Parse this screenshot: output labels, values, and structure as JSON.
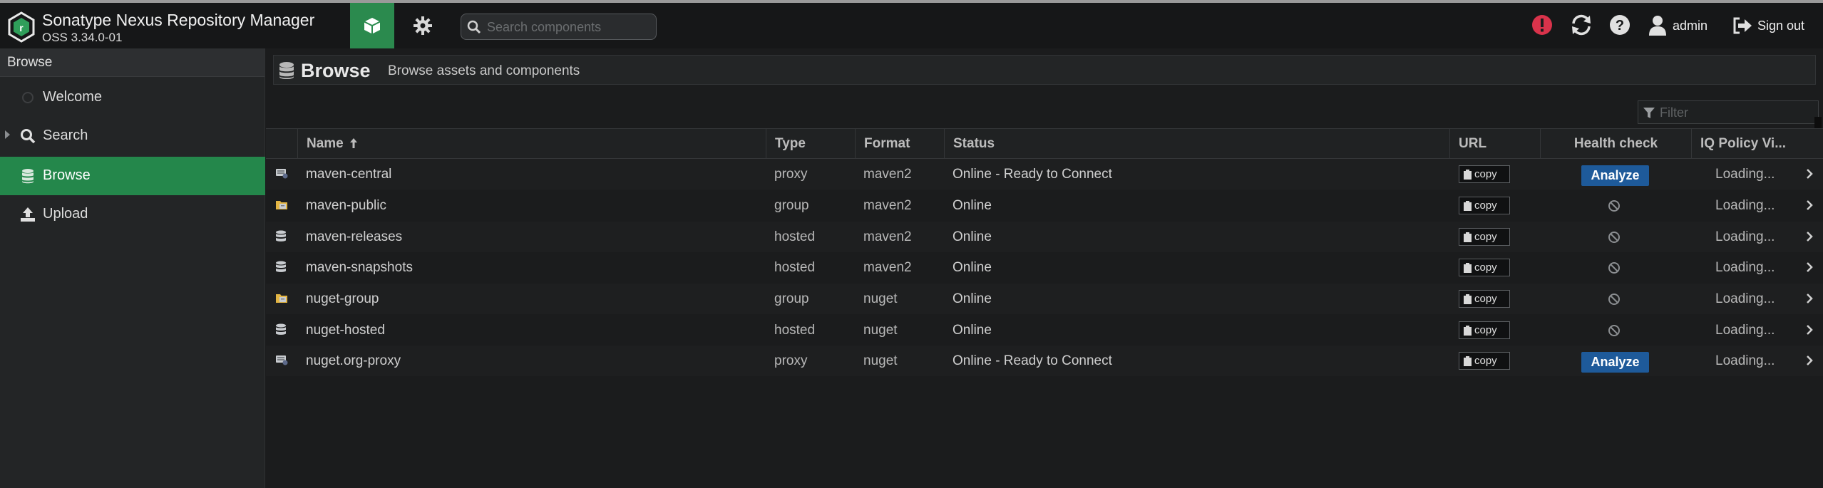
{
  "app": {
    "title": "Sonatype Nexus Repository Manager",
    "version": "OSS 3.34.0-01",
    "logo_letter": "r"
  },
  "header": {
    "browse_mode_icon": "cube-icon",
    "admin_mode_icon": "gear-icon",
    "search_placeholder": "Search components",
    "alert_icon": "alert-icon",
    "refresh_icon": "refresh-icon",
    "help_icon": "help-icon",
    "user_label": "admin",
    "signout_label": "Sign out"
  },
  "sidebar": {
    "heading": "Browse",
    "items": [
      {
        "label": "Welcome",
        "icon": "welcome-circle-icon",
        "expandable": false,
        "active": false
      },
      {
        "label": "Search",
        "icon": "search-icon",
        "expandable": true,
        "active": false
      },
      {
        "label": "Browse",
        "icon": "database-icon",
        "expandable": false,
        "active": true
      },
      {
        "label": "Upload",
        "icon": "upload-icon",
        "expandable": false,
        "active": false
      }
    ]
  },
  "main": {
    "title": "Browse",
    "subtitle": "Browse assets and components",
    "filter_placeholder": "Filter"
  },
  "table": {
    "columns": {
      "name": "Name",
      "type": "Type",
      "format": "Format",
      "status": "Status",
      "url": "URL",
      "health": "Health check",
      "iq": "IQ Policy Vi..."
    },
    "sort_icon": "sort-ascending-icon",
    "copy_label": "copy",
    "analyze_label": "Analyze",
    "rows": [
      {
        "name": "maven-central",
        "type": "proxy",
        "format": "maven2",
        "status": "Online - Ready to Connect",
        "health": "analyze",
        "iq": "Loading..."
      },
      {
        "name": "maven-public",
        "type": "group",
        "format": "maven2",
        "status": "Online",
        "health": "none",
        "iq": "Loading..."
      },
      {
        "name": "maven-releases",
        "type": "hosted",
        "format": "maven2",
        "status": "Online",
        "health": "none",
        "iq": "Loading..."
      },
      {
        "name": "maven-snapshots",
        "type": "hosted",
        "format": "maven2",
        "status": "Online",
        "health": "none",
        "iq": "Loading..."
      },
      {
        "name": "nuget-group",
        "type": "group",
        "format": "nuget",
        "status": "Online",
        "health": "none",
        "iq": "Loading..."
      },
      {
        "name": "nuget-hosted",
        "type": "hosted",
        "format": "nuget",
        "status": "Online",
        "health": "none",
        "iq": "Loading..."
      },
      {
        "name": "nuget.org-proxy",
        "type": "proxy",
        "format": "nuget",
        "status": "Online - Ready to Connect",
        "health": "analyze",
        "iq": "Loading..."
      }
    ]
  },
  "colors": {
    "accent_green": "#24874b",
    "analyze_blue": "#1e5a9a",
    "alert_red": "#d9334b"
  }
}
